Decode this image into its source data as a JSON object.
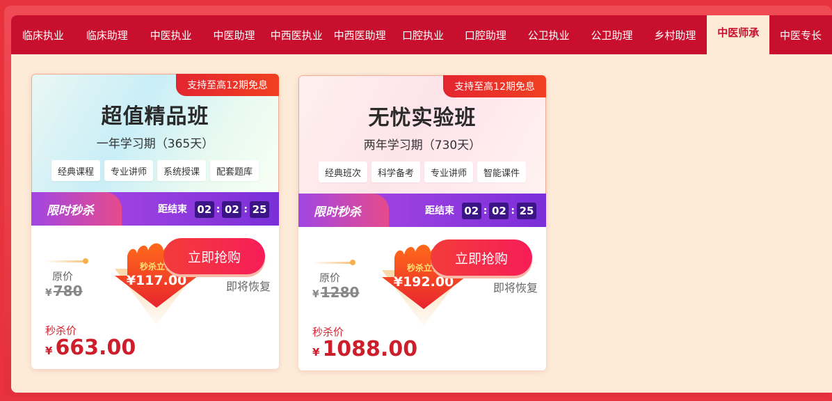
{
  "tabs": [
    {
      "label": "临床执业",
      "active": false
    },
    {
      "label": "临床助理",
      "active": false
    },
    {
      "label": "中医执业",
      "active": false
    },
    {
      "label": "中医助理",
      "active": false
    },
    {
      "label": "中西医执业",
      "active": false
    },
    {
      "label": "中西医助理",
      "active": false
    },
    {
      "label": "口腔执业",
      "active": false
    },
    {
      "label": "口腔助理",
      "active": false
    },
    {
      "label": "公卫执业",
      "active": false
    },
    {
      "label": "公卫助理",
      "active": false
    },
    {
      "label": "乡村助理",
      "active": false
    },
    {
      "label": "中医师承",
      "active": true
    },
    {
      "label": "中医专长",
      "active": false
    }
  ],
  "cards": [
    {
      "badge": "支持至高12期免息",
      "title": "超值精品班",
      "period": "一年学习期（365天）",
      "tags": [
        "经典课程",
        "专业讲师",
        "系统授课",
        "配套题库"
      ],
      "flash_label": "限时秒杀",
      "countdown_label": "距结束",
      "countdown": {
        "h": "02",
        "m": "02",
        "s": "25"
      },
      "orig_label": "原价",
      "currency": "¥",
      "orig_price": "780",
      "flame_top": "秒杀立省",
      "flame_price": "¥117.00",
      "coming_label": "即将恢复",
      "sale_label": "秒杀价",
      "sale_price": "663.00",
      "buy_label": "立即抢购"
    },
    {
      "badge": "支持至高12期免息",
      "title": "无忧实验班",
      "period": "两年学习期（730天）",
      "tags": [
        "经典班次",
        "科学备考",
        "专业讲师",
        "智能课件"
      ],
      "flash_label": "限时秒杀",
      "countdown_label": "距结束",
      "countdown": {
        "h": "02",
        "m": "02",
        "s": "25"
      },
      "orig_label": "原价",
      "currency": "¥",
      "orig_price": "1280",
      "flame_top": "秒杀立省",
      "flame_price": "¥192.00",
      "coming_label": "即将恢复",
      "sale_label": "秒杀价",
      "sale_price": "1088.00",
      "buy_label": "立即抢购"
    }
  ],
  "colors": {
    "brand_red": "#c8102e",
    "panel_bg": "#fdebd8",
    "flash_purple": "#8a35dd",
    "price_red": "#cc1f2b"
  }
}
